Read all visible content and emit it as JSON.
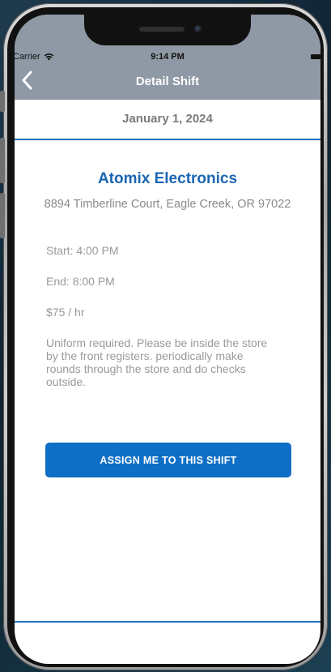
{
  "status_bar": {
    "carrier": "Carrier",
    "time": "9:14 PM"
  },
  "nav": {
    "title": "Detail Shift",
    "back_icon": "chevron-left-icon"
  },
  "shift": {
    "date": "January 1, 2024",
    "company": "Atomix Electronics",
    "address": "8894 Timberline Court, Eagle Creek, OR 97022",
    "start": "Start: 4:00 PM",
    "end": "End: 8:00 PM",
    "rate": "$75 / hr",
    "notes": "Uniform required. Please be inside the store by the front registers. periodically make rounds through the store and do checks outside."
  },
  "actions": {
    "assign_label": "ASSIGN ME TO THIS SHIFT"
  },
  "colors": {
    "nav_background": "#8e99a5",
    "accent": "#1f72c0",
    "button": "#0f6fc6",
    "company_text": "#1a66b3"
  }
}
